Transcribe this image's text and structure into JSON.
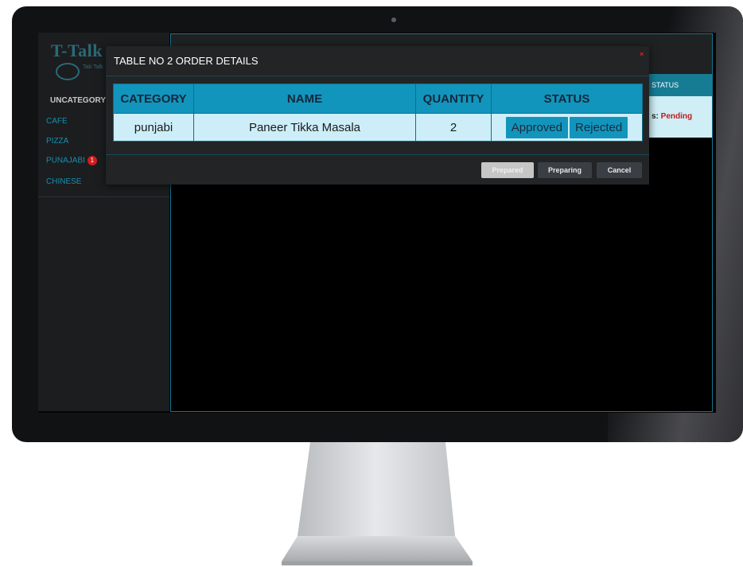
{
  "app": {
    "logo": "T-Talk",
    "logo_sub": "Tab Talk"
  },
  "sidebar": {
    "heading": "UNCATEGORY",
    "items": [
      {
        "label": "CAFE"
      },
      {
        "label": "PIZZA"
      },
      {
        "label": "PUNAJABI",
        "badge": "1"
      },
      {
        "label": "CHINESE"
      }
    ]
  },
  "main": {
    "status_header": "STATUS",
    "status_prefix": "s: ",
    "status_value": "Pending"
  },
  "modal": {
    "title": "TABLE NO 2 ORDER DETAILS",
    "close": "×",
    "table": {
      "headers": [
        "CATEGORY",
        "NAME",
        "QUANTITY",
        "STATUS"
      ],
      "rows": [
        {
          "category": "punjabi",
          "name": "Paneer Tikka Masala",
          "quantity": "2",
          "approved": "Approved",
          "rejected": "Rejected"
        }
      ]
    },
    "buttons": {
      "prepared": "Prepared",
      "preparing": "Preparing",
      "cancel": "Cancel"
    }
  },
  "colors": {
    "accent": "#1295bd",
    "pending": "#c41a1a",
    "badge": "#d21c1c"
  }
}
